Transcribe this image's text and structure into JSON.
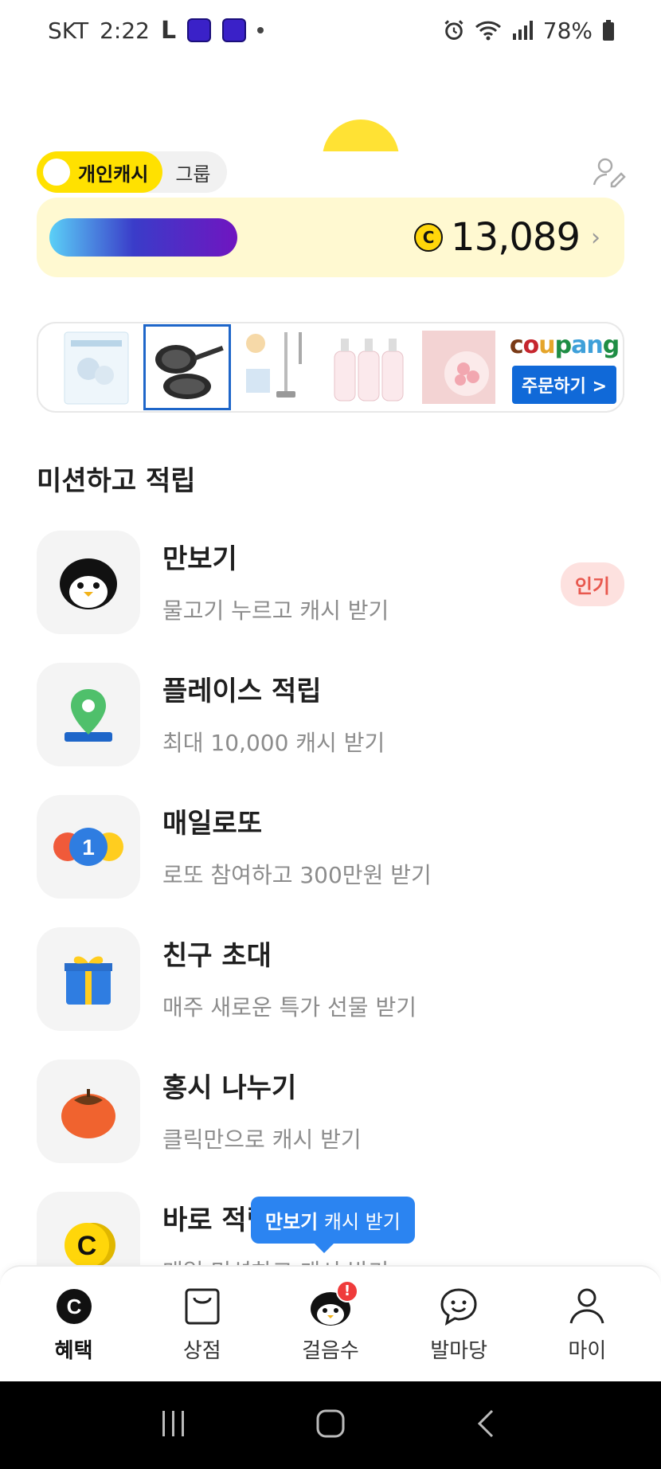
{
  "status_bar": {
    "carrier": "SKT",
    "time": "2:22",
    "battery": "78%"
  },
  "cash_toggle": {
    "personal_label": "개인캐시",
    "group_label": "그룹"
  },
  "balance": {
    "coin_symbol": "C",
    "amount": "13,089"
  },
  "ad_banner": {
    "brand": "coupang",
    "button_label": "주문하기 >"
  },
  "missions_section": {
    "title": "미션하고 적립",
    "items": [
      {
        "title": "만보기",
        "subtitle": "물고기 누르고 캐시 받기",
        "badge": "인기",
        "icon": "penguin-icon"
      },
      {
        "title": "플레이스 적립",
        "subtitle": "최대 10,000 캐시 받기",
        "icon": "map-pin-icon"
      },
      {
        "title": "매일로또",
        "subtitle": "로또 참여하고 300만원 받기",
        "icon": "lotto-ball-icon"
      },
      {
        "title": "친구 초대",
        "subtitle": "매주 새로운 특가 선물 받기",
        "icon": "gift-icon"
      },
      {
        "title": "홍시 나누기",
        "subtitle": "클릭만으로 캐시 받기",
        "icon": "persimmon-icon"
      },
      {
        "title": "바로 적립",
        "subtitle": "매일 미션하고 캐시 받기",
        "icon": "coin-icon"
      }
    ]
  },
  "tooltip": {
    "bold_text": "만보기",
    "text": " 캐시 받기"
  },
  "bottom_nav": {
    "items": [
      {
        "label": "혜택",
        "icon": "cash-c-icon",
        "active": true
      },
      {
        "label": "상점",
        "icon": "shopping-bag-icon"
      },
      {
        "label": "걸음수",
        "icon": "penguin-icon"
      },
      {
        "label": "발마당",
        "icon": "chat-bubble-icon"
      },
      {
        "label": "마이",
        "icon": "person-icon"
      }
    ]
  },
  "colors": {
    "accent_yellow": "#ffe100",
    "card_bg": "#fff9d1",
    "tooltip_blue": "#2b84f1",
    "badge_red": "#e8584e"
  }
}
